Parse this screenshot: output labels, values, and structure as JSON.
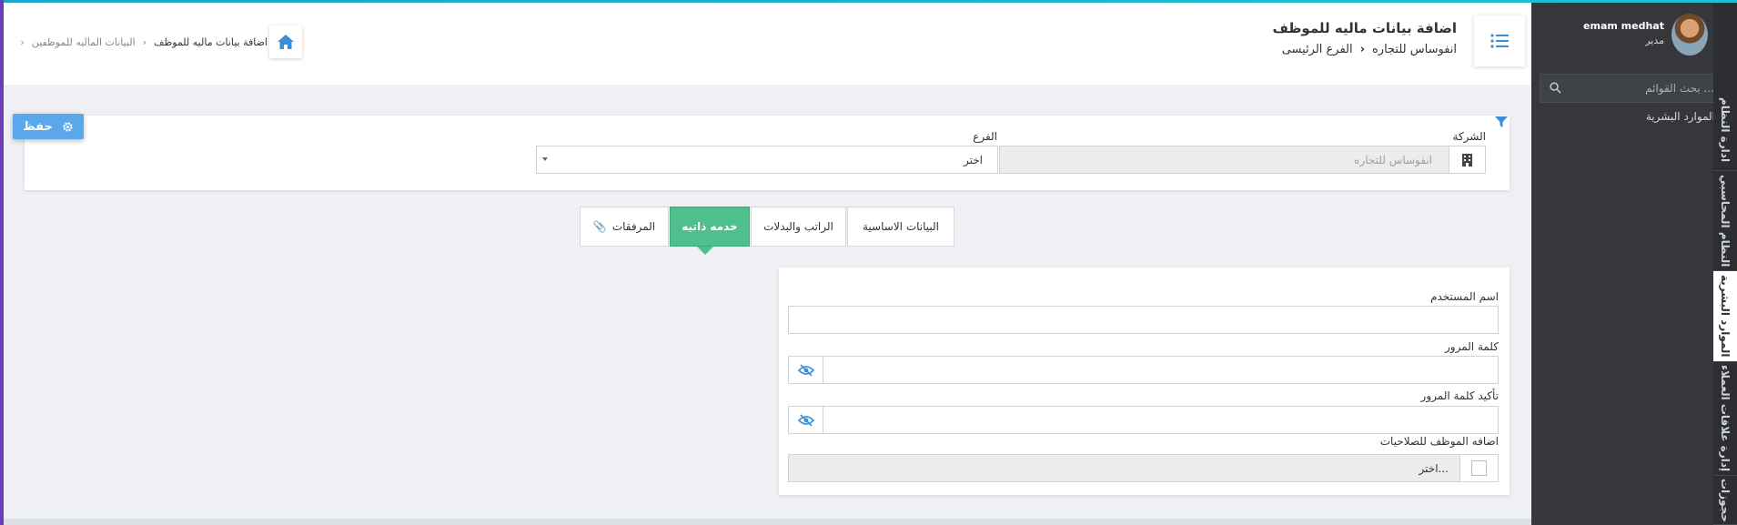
{
  "header": {
    "title": "اضافة بيانات ماليه للموظف",
    "company": "انفوساس للتجاره",
    "branch": "الفرع الرئيسى"
  },
  "breadcrumb": {
    "parent": "البيانات الماليه للموظفين",
    "current": "اضافة بيانات ماليه للموظف"
  },
  "sidebar": {
    "user_name": "emam medhat",
    "user_role": "مدير",
    "search_placeholder": "بحث القوائم ...",
    "menu_item": "الموارد البشرية",
    "vertical_tabs": [
      "ادارة النظام",
      "النظام المحاسبي",
      "الموارد البشرية",
      "إدارة علاقات العملاء",
      "حجوزات"
    ]
  },
  "toolbar": {
    "save_label": "حفظ"
  },
  "form": {
    "company_label": "الشركة",
    "company_value": "انفوساس للتجاره",
    "branch_label": "الفرع",
    "branch_value": "اختر"
  },
  "tabs": [
    {
      "label": "البيانات الاساسية"
    },
    {
      "label": "الراتب والبدلات"
    },
    {
      "label": "خدمه ذاتيه"
    },
    {
      "label": "المرفقات"
    }
  ],
  "self_service": {
    "username_label": "اسم المستخدم",
    "username_value": "",
    "password_label": "كلمة المرور",
    "password_confirm_label": "تأكيد كلمة المرور",
    "permissions_label": "اضافه الموظف للصلاحيات",
    "permissions_value": "اختر..."
  },
  "colors": {
    "accent_green": "#4fc08d",
    "save_blue": "#5aa7ec",
    "sidebar_dark": "#35373b",
    "icon_blue": "#3b8fd8"
  }
}
